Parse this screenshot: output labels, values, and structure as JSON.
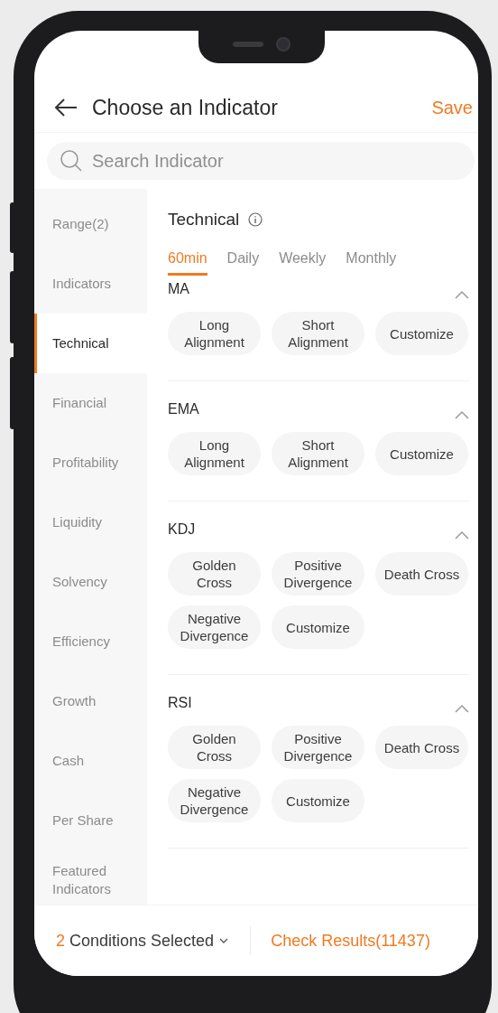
{
  "header": {
    "title": "Choose an Indicator",
    "action": "Save"
  },
  "search": {
    "placeholder": "Search Indicator"
  },
  "sidebar": {
    "items": [
      {
        "label": "Range(2)",
        "selected": false
      },
      {
        "label": "Indicators",
        "selected": false
      },
      {
        "label": "Technical",
        "selected": true
      },
      {
        "label": "Financial",
        "selected": false
      },
      {
        "label": "Profitability",
        "selected": false
      },
      {
        "label": "Liquidity",
        "selected": false
      },
      {
        "label": "Solvency",
        "selected": false
      },
      {
        "label": "Efficiency",
        "selected": false
      },
      {
        "label": "Growth",
        "selected": false
      },
      {
        "label": "Cash",
        "selected": false
      },
      {
        "label": "Per Share",
        "selected": false
      },
      {
        "label": "Featured Indicators",
        "selected": false
      }
    ]
  },
  "content": {
    "title": "Technical",
    "tabs": [
      {
        "label": "60min",
        "selected": true
      },
      {
        "label": "Daily",
        "selected": false
      },
      {
        "label": "Weekly",
        "selected": false
      },
      {
        "label": "Monthly",
        "selected": false
      }
    ],
    "sections": [
      {
        "name": "MA",
        "expanded": true,
        "options": [
          "Long Alignment",
          "Short Alignment",
          "Customize"
        ]
      },
      {
        "name": "EMA",
        "expanded": true,
        "options": [
          "Long Alignment",
          "Short Alignment",
          "Customize"
        ]
      },
      {
        "name": "KDJ",
        "expanded": true,
        "options": [
          "Golden Cross",
          "Positive Divergence",
          "Death Cross",
          "Negative Divergence",
          "Customize"
        ]
      },
      {
        "name": "RSI",
        "expanded": true,
        "options": [
          "Golden Cross",
          "Positive Divergence",
          "Death Cross",
          "Negative Divergence",
          "Customize"
        ]
      }
    ]
  },
  "footer": {
    "count": "2",
    "label": "Conditions Selected",
    "results": "Check Results(11437)"
  }
}
